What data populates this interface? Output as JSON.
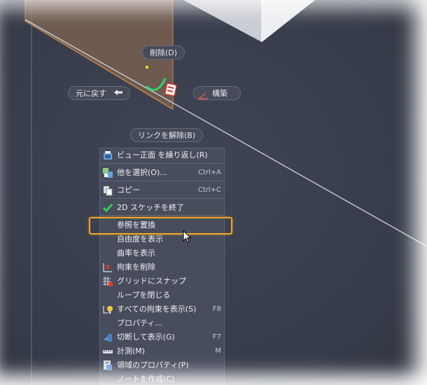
{
  "viewport": {
    "background": "#3b4150",
    "sketch_fill": "#6e5a4f",
    "sketch_edge": "#c8864a"
  },
  "markers": {
    "delete": "削除(D)",
    "undo": "元に戻す",
    "constrain": "構築",
    "unlink": "リンクを解除(B)"
  },
  "menu": {
    "items": [
      {
        "label": "ビュー正面 を繰り返し(R)",
        "shortcut": "",
        "icon": "view-face-icon"
      },
      {
        "label": "他を選択(O)...",
        "shortcut": "Ctrl+A",
        "icon": "select-other-icon"
      },
      {
        "label": "コピー",
        "shortcut": "Ctrl+C",
        "icon": "copy-icon"
      },
      {
        "label": "2D スケッチを終了",
        "shortcut": "",
        "icon": "checkmark-icon"
      },
      {
        "label": "参照を置換",
        "shortcut": "",
        "icon": ""
      },
      {
        "label": "自由度を表示",
        "shortcut": "",
        "icon": ""
      },
      {
        "label": "曲率を表示",
        "shortcut": "",
        "icon": ""
      },
      {
        "label": "拘束を削除",
        "shortcut": "",
        "icon": "delete-constraint-icon"
      },
      {
        "label": "グリッドにスナップ",
        "shortcut": "",
        "icon": "grid-snap-icon"
      },
      {
        "label": "ループを閉じる",
        "shortcut": "",
        "icon": ""
      },
      {
        "label": "すべての拘束を表示(S)",
        "shortcut": "F8",
        "icon": "show-constraints-icon"
      },
      {
        "label": "プロパティ...",
        "shortcut": "",
        "icon": ""
      },
      {
        "label": "切断して表示(G)",
        "shortcut": "F7",
        "icon": "slice-graphics-icon"
      },
      {
        "label": "計測(M)",
        "shortcut": "M",
        "icon": "measure-icon"
      },
      {
        "label": "領域のプロパティ(P)",
        "shortcut": "",
        "icon": "region-properties-icon"
      },
      {
        "label": "ノートを作成(C)",
        "shortcut": "",
        "icon": ""
      }
    ]
  },
  "colors": {
    "highlight": "#f0a623",
    "check": "#3cc957",
    "arc": "#2ed36c"
  }
}
